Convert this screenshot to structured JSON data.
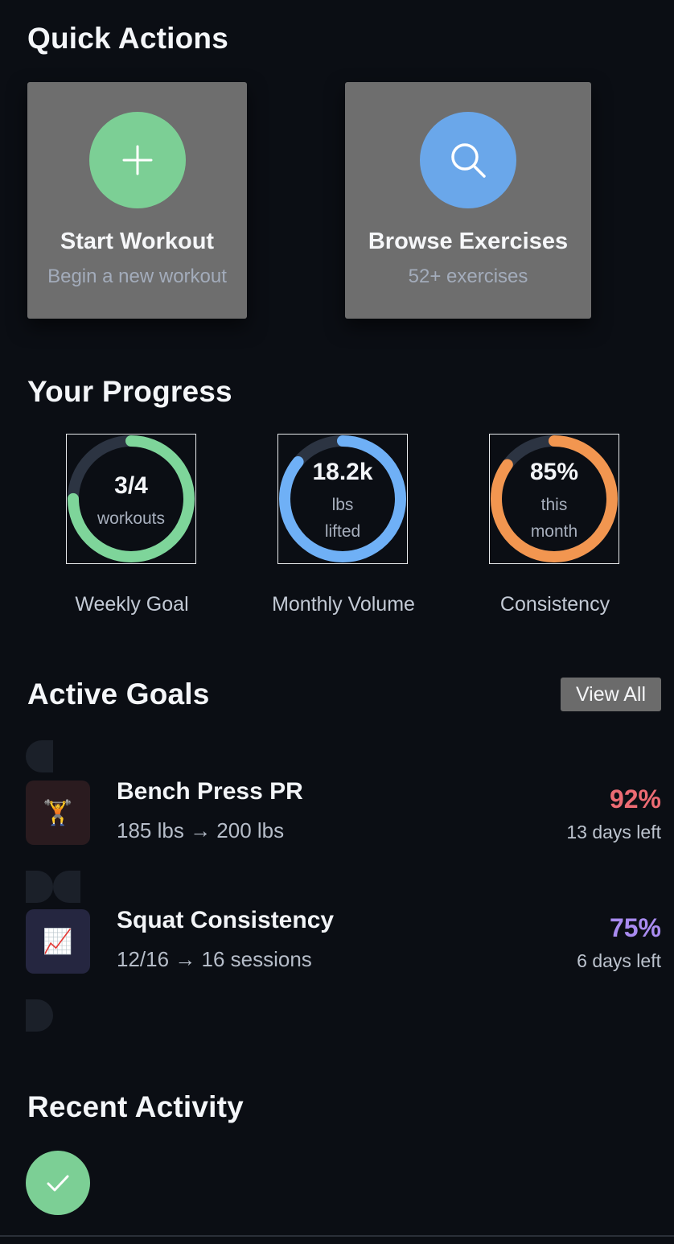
{
  "quick_actions": {
    "title": "Quick Actions",
    "items": [
      {
        "title": "Start Workout",
        "subtitle": "Begin a new workout",
        "icon": "plus-icon",
        "color": "#7ccf95"
      },
      {
        "title": "Browse Exercises",
        "subtitle": "52+ exercises",
        "icon": "search-icon",
        "color": "#6aa7ea"
      }
    ]
  },
  "progress": {
    "title": "Your Progress",
    "rings": [
      {
        "value": "3/4",
        "unit_lines": [
          "workouts"
        ],
        "label": "Weekly Goal",
        "fraction": 0.75,
        "color": "#7ed59a"
      },
      {
        "value": "18.2k",
        "unit_lines": [
          "lbs",
          "lifted"
        ],
        "label": "Monthly Volume",
        "fraction": 0.86,
        "color": "#6fb0f6"
      },
      {
        "value": "85%",
        "unit_lines": [
          "this",
          "month"
        ],
        "label": "Consistency",
        "fraction": 0.85,
        "color": "#f29650"
      }
    ]
  },
  "goals": {
    "title": "Active Goals",
    "view_all_label": "View All",
    "items": [
      {
        "title": "Bench Press PR",
        "detail": "185 lbs → 200 lbs",
        "percent": "92%",
        "days_left": "13 days left",
        "icon": "🏋️",
        "icon_name": "weightlifter-icon",
        "accent": "#ec6b73",
        "icon_bg": "#2a1b1f"
      },
      {
        "title": "Squat Consistency",
        "detail": "12/16 → 16 sessions",
        "percent": "75%",
        "days_left": "6 days left",
        "icon": "📈",
        "icon_name": "chart-increasing-icon",
        "accent": "#a98bf0",
        "icon_bg": "#252640"
      }
    ]
  },
  "activity": {
    "title": "Recent Activity",
    "icon": "check-icon",
    "icon_color": "#7ccf95"
  }
}
